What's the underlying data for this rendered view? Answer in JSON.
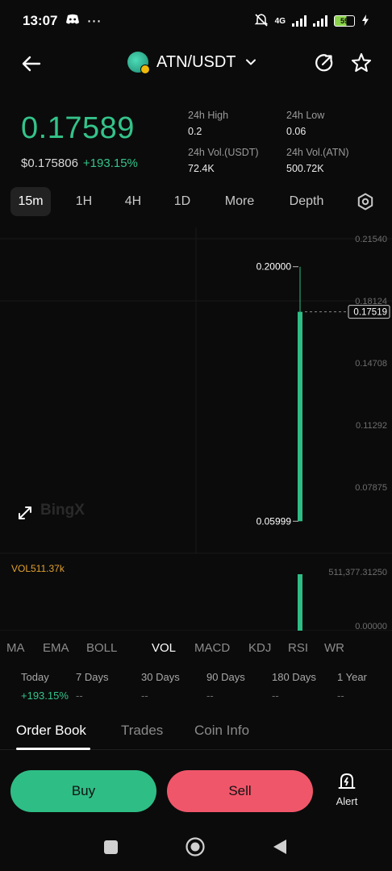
{
  "status": {
    "time": "13:07",
    "network": "4G",
    "battery": "59"
  },
  "header": {
    "pair": "ATN/USDT"
  },
  "price": {
    "last": "0.17589",
    "usd": "$0.175806",
    "change": "+193.15%"
  },
  "stats": {
    "high_label": "24h High",
    "high_value": "0.2",
    "low_label": "24h Low",
    "low_value": "0.06",
    "vol_usdt_label": "24h Vol.(USDT)",
    "vol_usdt_value": "72.4K",
    "vol_atn_label": "24h Vol.(ATN)",
    "vol_atn_value": "500.72K"
  },
  "timeframes": [
    "15m",
    "1H",
    "4H",
    "1D",
    "More",
    "Depth"
  ],
  "chart_data": {
    "type": "candlestick",
    "y_axis_ticks": [
      "0.21540",
      "0.18124",
      "0.14708",
      "0.11292",
      "0.07875"
    ],
    "ylim": [
      0.07875,
      0.2154
    ],
    "candles": [
      {
        "open": 0.05999,
        "high": 0.2,
        "low": 0.05999,
        "close": 0.17519
      }
    ],
    "high_label": "0.20000",
    "low_label": "0.05999",
    "last_price_label": "0.17519",
    "watermark": "BingX",
    "volume": {
      "label": "VOL511.37k",
      "axis_ticks": [
        "511,377.31250",
        "0.00000"
      ],
      "values": [
        511377.3125
      ],
      "max": 511377.3125
    }
  },
  "indicators": [
    "MA",
    "EMA",
    "BOLL",
    "VOL",
    "MACD",
    "KDJ",
    "RSI",
    "WR"
  ],
  "performance": [
    {
      "label": "Today",
      "value": "+193.15%"
    },
    {
      "label": "7 Days",
      "value": "--"
    },
    {
      "label": "30 Days",
      "value": "--"
    },
    {
      "label": "90 Days",
      "value": "--"
    },
    {
      "label": "180 Days",
      "value": "--"
    },
    {
      "label": "1 Year",
      "value": "--"
    }
  ],
  "tabs": [
    "Order Book",
    "Trades",
    "Coin Info"
  ],
  "actions": {
    "buy": "Buy",
    "sell": "Sell",
    "alert": "Alert"
  },
  "colors": {
    "up": "#2ebd85",
    "down": "#f0566a",
    "volume_label": "#e0a030"
  }
}
